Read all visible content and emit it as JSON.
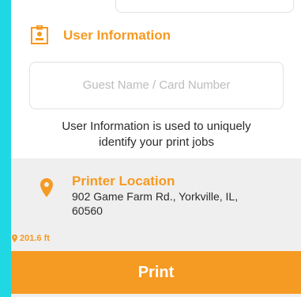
{
  "user_info": {
    "title": "User Information",
    "input_placeholder": "Guest Name / Card Number",
    "helper_text": "User Information is used to uniquely identify your print jobs"
  },
  "printer_location": {
    "title": "Printer Location",
    "address": "902 Game Farm Rd., Yorkville, IL, 60560",
    "distance": "201.6 ft"
  },
  "actions": {
    "print_label": "Print"
  },
  "colors": {
    "accent": "#F59A23",
    "background": "#1FD8E3",
    "panel": "#EFEFEF",
    "card": "#FFFFFF"
  },
  "icons": {
    "user_info_icon": "id-badge-icon",
    "location_icon": "map-pin-icon",
    "distance_icon": "small-map-pin-icon"
  }
}
